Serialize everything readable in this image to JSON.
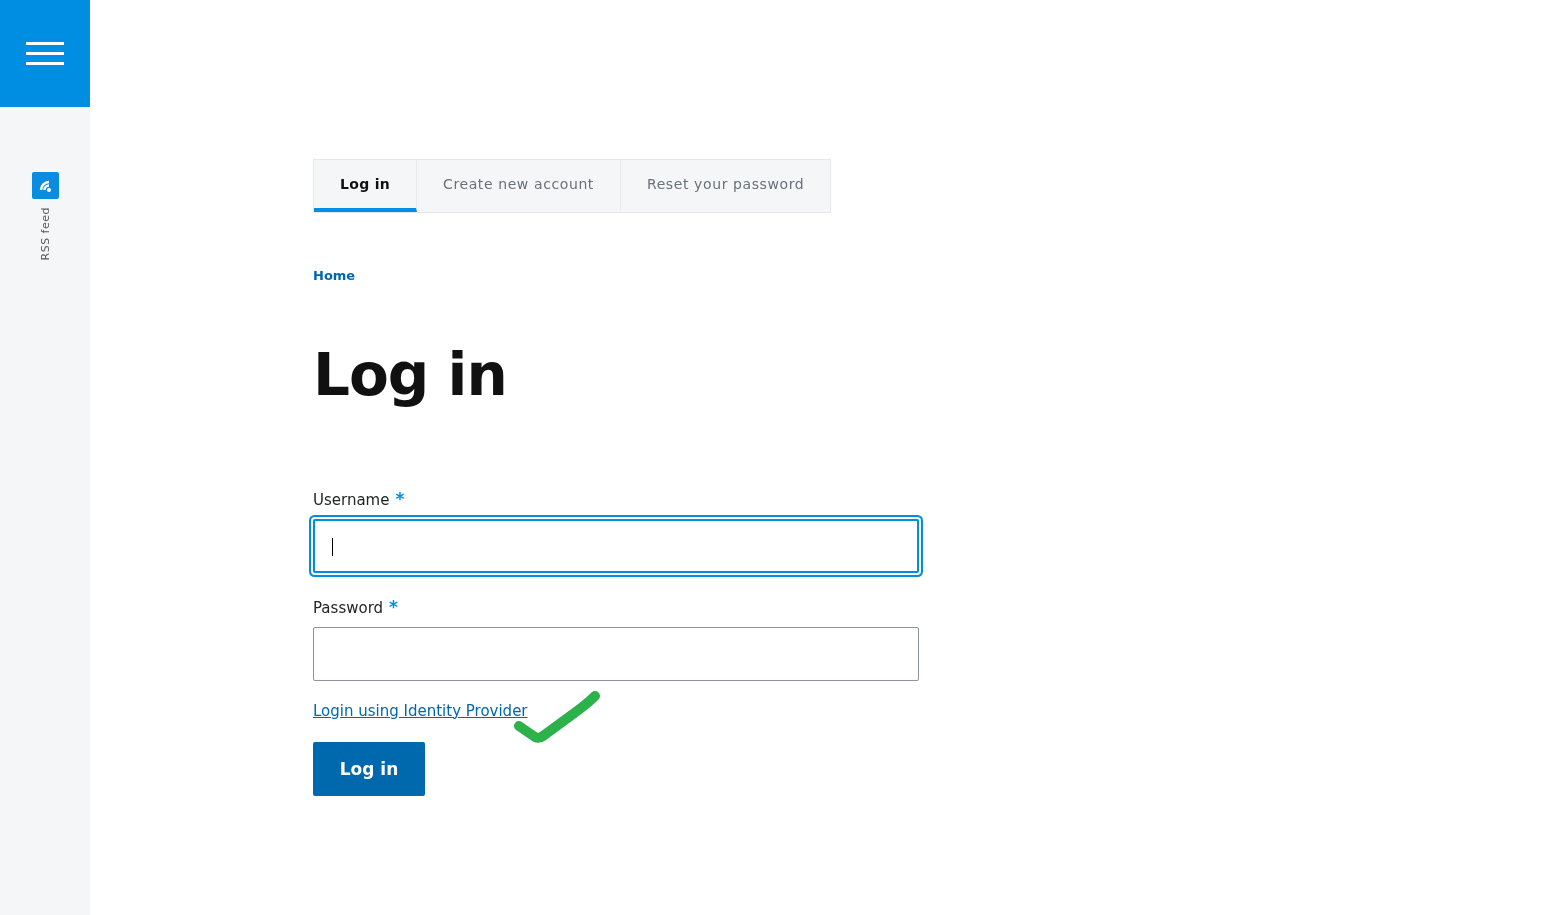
{
  "sidebar": {
    "items": [
      {
        "label": "RSS feed",
        "kind": "rss"
      }
    ]
  },
  "tabs": [
    {
      "label": "Log in",
      "selected": true
    },
    {
      "label": "Create new account",
      "selected": false
    },
    {
      "label": "Reset your password",
      "selected": false
    }
  ],
  "breadcrumb": [
    "Home"
  ],
  "title": "Log in",
  "fields": [
    {
      "label": "Username",
      "required_mark": "*",
      "focused": true
    },
    {
      "label": "Password",
      "required_mark": "*",
      "focused": false
    }
  ],
  "link": "Login using Identity Provider",
  "annotation": {
    "kind": "checkmark",
    "color": "#2db14a"
  },
  "submit_button": "Log in"
}
